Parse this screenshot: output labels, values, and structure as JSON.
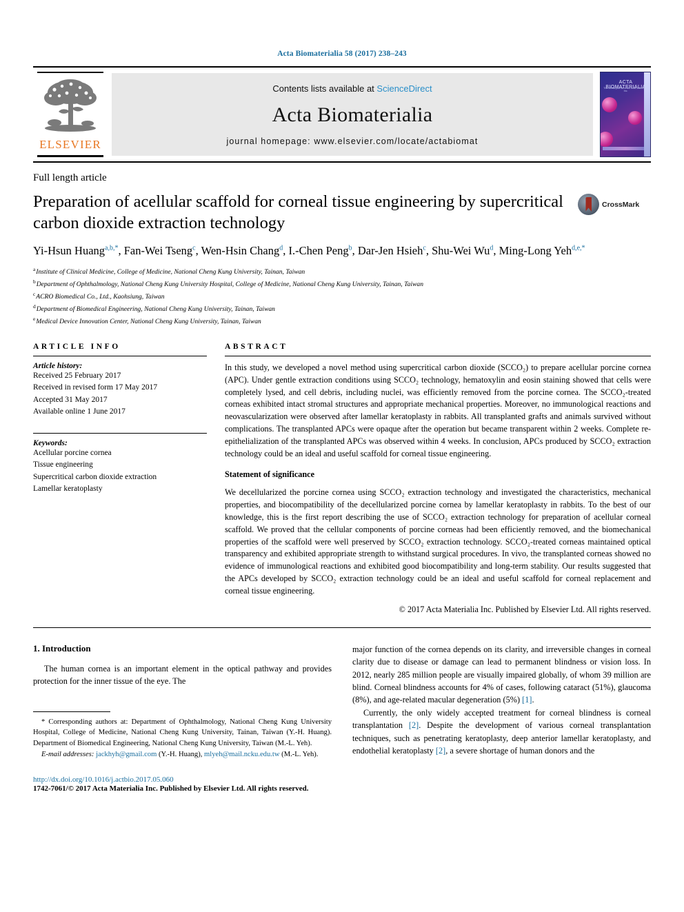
{
  "running_head": "Acta Biomaterialia 58 (2017) 238–243",
  "masthead": {
    "contents_prefix": "Contents lists available at ",
    "sciencedirect": "ScienceDirect",
    "journal_name": "Acta Biomaterialia",
    "homepage": "journal homepage: www.elsevier.com/locate/actabiomat",
    "publisher_word": "ELSEVIER",
    "cover_title": "ACTA BIOMATERIALIA",
    "cover_subtitle": "The official journal of the Acta Materialia, Inc."
  },
  "article_type": "Full length article",
  "title": "Preparation of acellular scaffold for corneal tissue engineering by supercritical carbon dioxide extraction technology",
  "crossmark_label": "CrossMark",
  "authors": [
    {
      "name": "Yi-Hsun Huang",
      "sup": "a,b,*"
    },
    {
      "name": "Fan-Wei Tseng",
      "sup": "c"
    },
    {
      "name": "Wen-Hsin Chang",
      "sup": "d"
    },
    {
      "name": "I.-Chen Peng",
      "sup": "b"
    },
    {
      "name": "Dar-Jen Hsieh",
      "sup": "c"
    },
    {
      "name": "Shu-Wei Wu",
      "sup": "d"
    },
    {
      "name": "Ming-Long Yeh",
      "sup": "d,e,*"
    }
  ],
  "affiliations": [
    {
      "label": "a",
      "text": "Institute of Clinical Medicine, College of Medicine, National Cheng Kung University, Tainan, Taiwan"
    },
    {
      "label": "b",
      "text": "Department of Ophthalmology, National Cheng Kung University Hospital, College of Medicine, National Cheng Kung University, Tainan, Taiwan"
    },
    {
      "label": "c",
      "text": "ACRO Biomedical Co., Ltd., Kaohsiung, Taiwan"
    },
    {
      "label": "d",
      "text": "Department of Biomedical Engineering, National Cheng Kung University, Tainan, Taiwan"
    },
    {
      "label": "e",
      "text": "Medical Device Innovation Center, National Cheng Kung University, Tainan, Taiwan"
    }
  ],
  "article_info": {
    "heading": "ARTICLE INFO",
    "history_label": "Article history:",
    "history": [
      "Received 25 February 2017",
      "Received in revised form 17 May 2017",
      "Accepted 31 May 2017",
      "Available online 1 June 2017"
    ],
    "keywords_label": "Keywords:",
    "keywords": [
      "Acellular porcine cornea",
      "Tissue engineering",
      "Supercritical carbon dioxide extraction",
      "Lamellar keratoplasty"
    ]
  },
  "abstract": {
    "heading": "ABSTRACT",
    "body": "In this study, we developed a novel method using supercritical carbon dioxide (SCCO₂) to prepare acellular porcine cornea (APC). Under gentle extraction conditions using SCCO₂ technology, hematoxylin and eosin staining showed that cells were completely lysed, and cell debris, including nuclei, was efficiently removed from the porcine cornea. The SCCO₂-treated corneas exhibited intact stromal structures and appropriate mechanical properties. Moreover, no immunological reactions and neovascularization were observed after lamellar keratoplasty in rabbits. All transplanted grafts and animals survived without complications. The transplanted APCs were opaque after the operation but became transparent within 2 weeks. Complete re-epithelialization of the transplanted APCs was observed within 4 weeks. In conclusion, APCs produced by SCCO₂ extraction technology could be an ideal and useful scaffold for corneal tissue engineering.",
    "significance_heading": "Statement of significance",
    "significance_body": "We decellularized the porcine cornea using SCCO₂ extraction technology and investigated the characteristics, mechanical properties, and biocompatibility of the decellularized porcine cornea by lamellar keratoplasty in rabbits. To the best of our knowledge, this is the first report describing the use of SCCO₂ extraction technology for preparation of acellular corneal scaffold. We proved that the cellular components of porcine corneas had been efficiently removed, and the biomechanical properties of the scaffold were well preserved by SCCO₂ extraction technology. SCCO₂-treated corneas maintained optical transparency and exhibited appropriate strength to withstand surgical procedures. In vivo, the transplanted corneas showed no evidence of immunological reactions and exhibited good biocompatibility and long-term stability. Our results suggested that the APCs developed by SCCO₂ extraction technology could be an ideal and useful scaffold for corneal replacement and corneal tissue engineering.",
    "copyright": "© 2017 Acta Materialia Inc. Published by Elsevier Ltd. All rights reserved."
  },
  "introduction": {
    "heading": "1. Introduction",
    "left_paragraph": "The human cornea is an important element in the optical pathway and provides protection for the inner tissue of the eye. The",
    "right_paragraph_1_start": "major function of the cornea depends on its clarity, and irreversible changes in corneal clarity due to disease or damage can lead to permanent blindness or vision loss. In 2012, nearly 285 million people are visually impaired globally, of whom 39 million are blind. Corneal blindness accounts for 4% of cases, following cataract (51%), glaucoma (8%), and age-related macular degeneration (5%) ",
    "ref_1": "[1]",
    "right_paragraph_1_end": ".",
    "right_paragraph_2_start": "Currently, the only widely accepted treatment for corneal blindness is corneal transplantation ",
    "ref_2a": "[2]",
    "right_paragraph_2_mid": ". Despite the development of various corneal transplantation techniques, such as penetrating keratoplasty, deep anterior lamellar keratoplasty, and endothelial keratoplasty ",
    "ref_2b": "[2]",
    "right_paragraph_2_end": ", a severe shortage of human donors and the"
  },
  "footnotes": {
    "corresponding_symbol": "*",
    "corresponding_text": " Corresponding authors at: Department of Ophthalmology, National Cheng Kung University Hospital, College of Medicine, National Cheng Kung University, Tainan, Taiwan (Y.-H. Huang). Department of Biomedical Engineering, National Cheng Kung University, Taiwan (M.-L. Yeh).",
    "email_label": "E-mail addresses:",
    "email_1": "jackhyh@gmail.com",
    "email_1_owner": " (Y.-H. Huang), ",
    "email_2": "mlyeh@mail.ncku.edu.tw",
    "email_2_owner": " (M.-L. Yeh).",
    "doi": "http://dx.doi.org/10.1016/j.actbio.2017.05.060",
    "issn_line": "1742-7061/© 2017 Acta Materialia Inc. Published by Elsevier Ltd. All rights reserved."
  },
  "colors": {
    "link": "#1a6e9e",
    "sciencedirect": "#2b8fc9",
    "elsevier_orange": "#E87722"
  }
}
